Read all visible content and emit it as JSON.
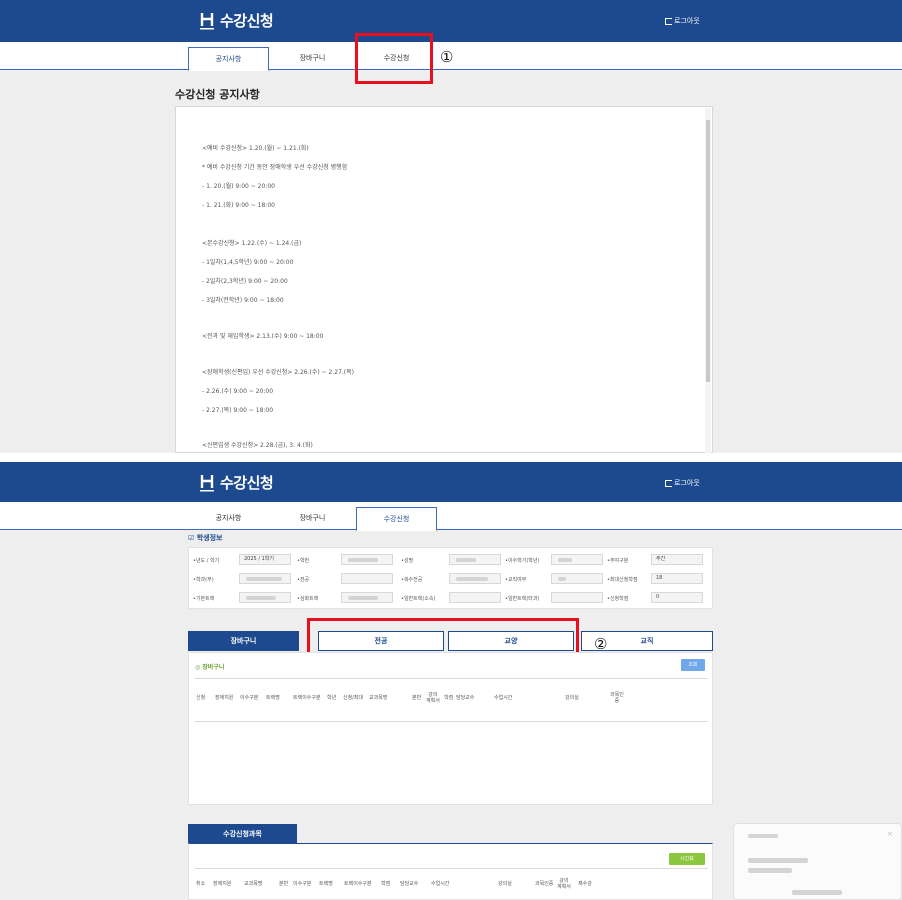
{
  "app": {
    "title": "수강신청",
    "logout_label": "로그아웃"
  },
  "tabs": [
    "공지사항",
    "장바구니",
    "수강신청"
  ],
  "callouts": {
    "first": "①",
    "second": "②"
  },
  "notice": {
    "title": "수강신청 공지사항",
    "lines": [
      "<예비 수강신청> 1.20.(월) ~ 1.21.(화)",
      "* 예비 수강신청 기간 동안 장애학생 우선 수강신청 병행함",
      "- 1. 20.(월) 9:00 ~ 20:00",
      "- 1. 21.(화) 9:00 ~ 18:00",
      "<본수강신청> 1.22.(수) ~ 1.24.(금)",
      "- 1일차(1,4,5학년) 9:00 ~ 20:00",
      "- 2일차(2,3학년) 9:00 ~ 20:00",
      "- 3일차(전학년) 9:00 ~ 18:00",
      "<전과 및 재입학생> 2.13.(수) 9:00 ~ 18:00",
      "<장애학생(신편입) 우선 수강신청> 2.26.(수) ~ 2.27.(목)",
      "- 2.26.(수) 9:00 ~ 20:00",
      "- 2.27.(목) 9:00 ~ 18:00",
      "<신편입생 수강신청> 2.28.(금), 3. 4.(화)"
    ]
  },
  "student_info": {
    "section_title": "학생정보",
    "fields": {
      "year_term": {
        "label": "•년도 / 학기",
        "value": "2025 / 1학기"
      },
      "student_no": {
        "label": "•학번",
        "value": ""
      },
      "name": {
        "label": "•성명",
        "value": ""
      },
      "completed_term": {
        "label": "•이수학기(학년)",
        "value": ""
      },
      "day_night": {
        "label": "•주야구분",
        "value": "주간"
      },
      "dept": {
        "label": "•학과(부)",
        "value": ""
      },
      "major": {
        "label": "•전공",
        "value": ""
      },
      "double_major": {
        "label": "•복수전공",
        "value": ""
      },
      "teaching": {
        "label": "•교직여부",
        "value": ""
      },
      "max_credits": {
        "label": "•최대신청학점",
        "value": "18"
      },
      "basic_track": {
        "label": "•기본트랙",
        "value": ""
      },
      "deep_track": {
        "label": "•심화트랙",
        "value": ""
      },
      "general_track_minor": {
        "label": "•일반트랙(소속)",
        "value": ""
      },
      "general_track_other": {
        "label": "•일반트랙(타과)",
        "value": ""
      },
      "applied_credits": {
        "label": "•신청학점",
        "value": "0"
      }
    }
  },
  "main_tabs": [
    "장바구니",
    "전공",
    "교양",
    "교직"
  ],
  "cart": {
    "title": "장바구니",
    "search_label": "조회",
    "columns": [
      "신청",
      "장애지원",
      "이수구분",
      "트랙명",
      "트랙이수구분",
      "학년",
      "신청/최대",
      "교과목명",
      "분반",
      "강의\n계획서",
      "학점",
      "담당교수",
      "수업시간",
      "강의실",
      "과목인\n증"
    ]
  },
  "registered": {
    "tab_label": "수강신청과목",
    "timetable_label": "시간표",
    "columns": [
      "취소",
      "장애지원",
      "교과목명",
      "분반",
      "이수구분",
      "트랙명",
      "트랙이수구분",
      "학점",
      "담당교수",
      "수업시간",
      "강의실",
      "과목인증",
      "강의\n계획서",
      "재수강"
    ]
  },
  "colors": {
    "header_bg": "#1d4a8f",
    "callout": "#e8101c",
    "green_button": "#8dc63f",
    "blue_button": "#6fa8e8"
  }
}
